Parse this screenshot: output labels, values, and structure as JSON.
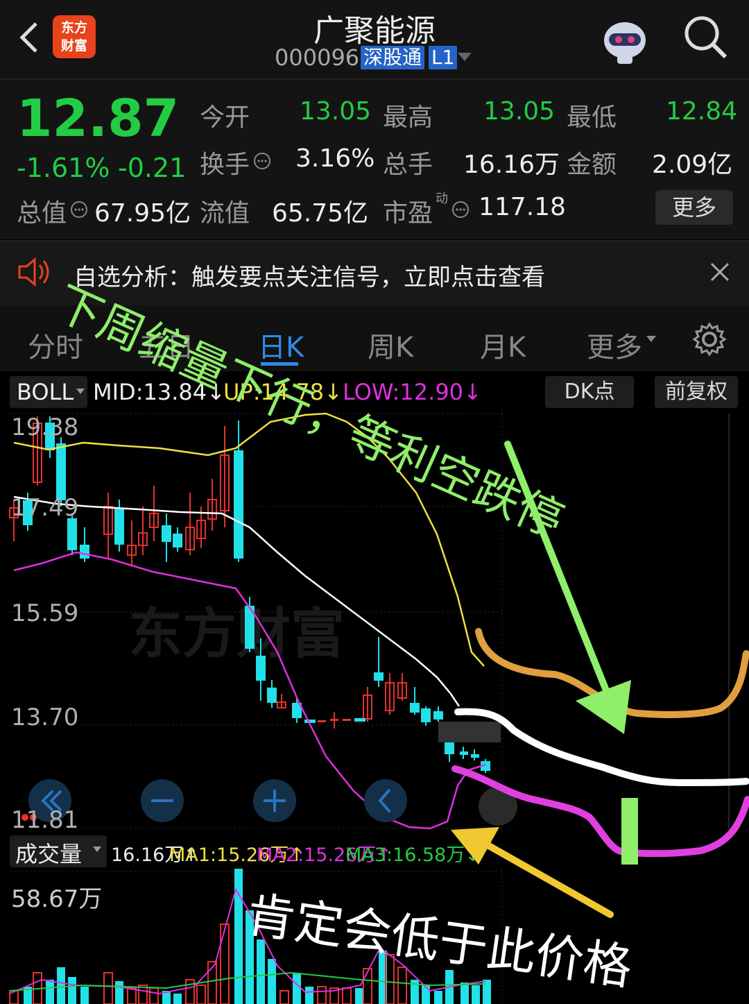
{
  "header": {
    "logo_line1": "东方",
    "logo_line2": "财富",
    "stock_name": "广聚能源",
    "stock_code": "000096",
    "tag_connect": "深股通",
    "tag_level": "L1"
  },
  "quote": {
    "price": "12.87",
    "change_pct": "-1.61%",
    "change_amt": "-0.21",
    "open_label": "今开",
    "open_value": "13.05",
    "high_label": "最高",
    "high_value": "13.05",
    "low_label": "最低",
    "low_value": "12.84",
    "turnover_label": "换手",
    "turnover_value": "3.16%",
    "volume_label": "总手",
    "volume_value": "16.16万",
    "amount_label": "金额",
    "amount_value": "2.09亿",
    "total_mv_label": "总值",
    "total_mv_value": "67.95亿",
    "float_mv_label": "流值",
    "float_mv_value": "65.75亿",
    "pe_label": "市盈",
    "pe_sup": "动",
    "pe_value": "117.18",
    "more_label": "更多"
  },
  "notice": {
    "text": "自选分析：触发要点关注信号，立即点击查看"
  },
  "tabs": {
    "fenshi": "分时",
    "wuri": "五日",
    "rik": "日K",
    "zhouk": "周K",
    "yuek": "月K",
    "more": "更多"
  },
  "indicator": {
    "name": "BOLL",
    "mid": "MID:13.84",
    "up": "UP:14.78",
    "low": "LOW:12.90",
    "arrow": "↓",
    "dk_btn": "DK点",
    "fq_btn": "前复权"
  },
  "price_axis": [
    "19.38",
    "17.49",
    "15.59",
    "13.70",
    "11.81"
  ],
  "watermark": "东方财富",
  "volume": {
    "label": "成交量",
    "vol": "16.16万↑",
    "ma1": "MA1:15.26万↑",
    "ma2": "MA2:15.26万↑",
    "ma3": "MA3:16.58万↓",
    "axis_max": "58.67万"
  },
  "annotations": {
    "green_text": "下周缩量下行，等利空跌停",
    "white_text": "肯定会低于此价格"
  },
  "colors": {
    "up": "#e5322d",
    "down": "#22e0e8",
    "green": "#22cc44",
    "upper_band": "#f0e040",
    "mid_band": "#ffffff",
    "lower_band": "#e030e0",
    "hand_green": "#8fee6a",
    "hand_orange": "#e0a040",
    "hand_pink": "#e040e0",
    "hand_yellow": "#f0c830"
  }
}
